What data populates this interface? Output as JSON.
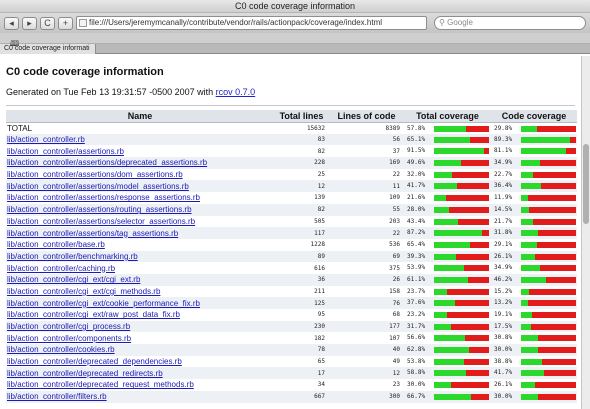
{
  "window": {
    "title": "C0 code coverage information"
  },
  "toolbar": {
    "back_label": "◂",
    "forward_label": "▸",
    "reload_label": "C",
    "add_label": "+",
    "url": "file:///Users/jeremymcanally/contribute/vendor/rails/actionpack/coverage/index.html",
    "search_placeholder": "Google"
  },
  "bookmarks": {
    "icon_label": "🕮"
  },
  "tab": {
    "label": "C0 code coverage informati"
  },
  "page": {
    "heading": "C0 code coverage information",
    "generated_prefix": "Generated on Tue Feb 13 19:31:57 -0500 2007 with",
    "rcov_link": "rcov 0.7.0"
  },
  "table": {
    "headers": [
      "Name",
      "Total lines",
      "Lines of code",
      "Total coverage",
      "Code coverage"
    ],
    "rows": [
      {
        "name": "TOTAL",
        "total": "15632",
        "code": "8389",
        "tcov": "57.8%",
        "tval": 57.8,
        "ccov": "29.8%",
        "cval": 29.8
      },
      {
        "name": "lib/action_controller.rb",
        "total": "83",
        "code": "56",
        "tcov": "65.1%",
        "tval": 65.1,
        "ccov": "89.3%",
        "cval": 89.3
      },
      {
        "name": "lib/action_controller/assertions.rb",
        "total": "82",
        "code": "37",
        "tcov": "91.5%",
        "tval": 91.5,
        "ccov": "81.1%",
        "cval": 81.1
      },
      {
        "name": "lib/action_controller/assertions/deprecated_assertions.rb",
        "total": "228",
        "code": "169",
        "tcov": "49.6%",
        "tval": 49.6,
        "ccov": "34.9%",
        "cval": 34.9
      },
      {
        "name": "lib/action_controller/assertions/dom_assertions.rb",
        "total": "25",
        "code": "22",
        "tcov": "32.0%",
        "tval": 32.0,
        "ccov": "22.7%",
        "cval": 22.7
      },
      {
        "name": "lib/action_controller/assertions/model_assertions.rb",
        "total": "12",
        "code": "11",
        "tcov": "41.7%",
        "tval": 41.7,
        "ccov": "36.4%",
        "cval": 36.4
      },
      {
        "name": "lib/action_controller/assertions/response_assertions.rb",
        "total": "139",
        "code": "109",
        "tcov": "21.6%",
        "tval": 21.6,
        "ccov": "11.9%",
        "cval": 11.9
      },
      {
        "name": "lib/action_controller/assertions/routing_assertions.rb",
        "total": "82",
        "code": "55",
        "tcov": "28.0%",
        "tval": 28.0,
        "ccov": "14.5%",
        "cval": 14.5
      },
      {
        "name": "lib/action_controller/assertions/selector_assertions.rb",
        "total": "505",
        "code": "203",
        "tcov": "43.4%",
        "tval": 43.4,
        "ccov": "21.7%",
        "cval": 21.7
      },
      {
        "name": "lib/action_controller/assertions/tag_assertions.rb",
        "total": "117",
        "code": "22",
        "tcov": "87.2%",
        "tval": 87.2,
        "ccov": "31.8%",
        "cval": 31.8
      },
      {
        "name": "lib/action_controller/base.rb",
        "total": "1228",
        "code": "536",
        "tcov": "65.4%",
        "tval": 65.4,
        "ccov": "29.1%",
        "cval": 29.1
      },
      {
        "name": "lib/action_controller/benchmarking.rb",
        "total": "89",
        "code": "69",
        "tcov": "39.3%",
        "tval": 39.3,
        "ccov": "26.1%",
        "cval": 26.1
      },
      {
        "name": "lib/action_controller/caching.rb",
        "total": "616",
        "code": "375",
        "tcov": "53.9%",
        "tval": 53.9,
        "ccov": "34.9%",
        "cval": 34.9
      },
      {
        "name": "lib/action_controller/cgi_ext/cgi_ext.rb",
        "total": "36",
        "code": "26",
        "tcov": "61.1%",
        "tval": 61.1,
        "ccov": "46.2%",
        "cval": 46.2
      },
      {
        "name": "lib/action_controller/cgi_ext/cgi_methods.rb",
        "total": "211",
        "code": "158",
        "tcov": "23.7%",
        "tval": 23.7,
        "ccov": "15.2%",
        "cval": 15.2
      },
      {
        "name": "lib/action_controller/cgi_ext/cookie_performance_fix.rb",
        "total": "125",
        "code": "76",
        "tcov": "37.6%",
        "tval": 37.6,
        "ccov": "13.2%",
        "cval": 13.2
      },
      {
        "name": "lib/action_controller/cgi_ext/raw_post_data_fix.rb",
        "total": "95",
        "code": "68",
        "tcov": "23.2%",
        "tval": 23.2,
        "ccov": "19.1%",
        "cval": 19.1
      },
      {
        "name": "lib/action_controller/cgi_process.rb",
        "total": "230",
        "code": "177",
        "tcov": "31.7%",
        "tval": 31.7,
        "ccov": "17.5%",
        "cval": 17.5
      },
      {
        "name": "lib/action_controller/components.rb",
        "total": "182",
        "code": "107",
        "tcov": "56.6%",
        "tval": 56.6,
        "ccov": "30.8%",
        "cval": 30.8
      },
      {
        "name": "lib/action_controller/cookies.rb",
        "total": "78",
        "code": "40",
        "tcov": "62.8%",
        "tval": 62.8,
        "ccov": "30.0%",
        "cval": 30.0
      },
      {
        "name": "lib/action_controller/deprecated_dependencies.rb",
        "total": "65",
        "code": "49",
        "tcov": "53.8%",
        "tval": 53.8,
        "ccov": "38.8%",
        "cval": 38.8
      },
      {
        "name": "lib/action_controller/deprecated_redirects.rb",
        "total": "17",
        "code": "12",
        "tcov": "58.8%",
        "tval": 58.8,
        "ccov": "41.7%",
        "cval": 41.7
      },
      {
        "name": "lib/action_controller/deprecated_request_methods.rb",
        "total": "34",
        "code": "23",
        "tcov": "30.0%",
        "tval": 30.0,
        "ccov": "26.1%",
        "cval": 26.1
      },
      {
        "name": "lib/action_controller/filters.rb",
        "total": "667",
        "code": "300",
        "tcov": "66.7%",
        "tval": 66.7,
        "ccov": "30.0%",
        "cval": 30.0
      }
    ]
  },
  "colors": {
    "covered": "#2bd82b",
    "uncovered": "#e21b1b",
    "link": "#1a1ab8"
  }
}
